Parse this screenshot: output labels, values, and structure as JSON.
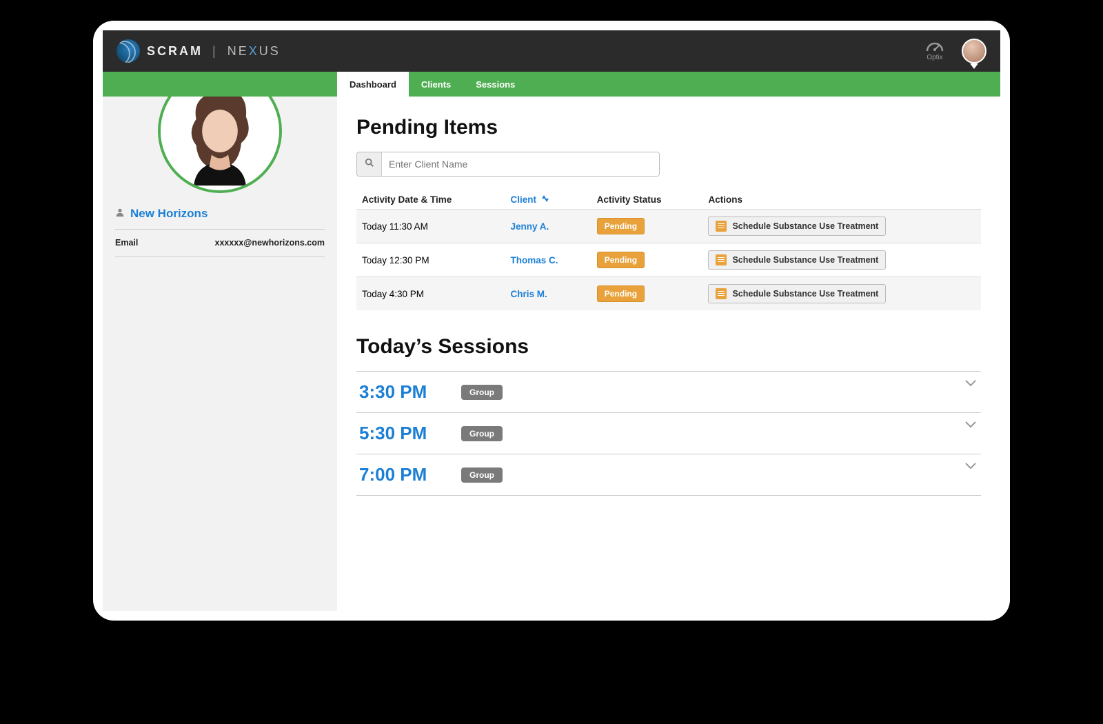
{
  "brand": {
    "scram": "SCRAM",
    "nexus_pre": "NE",
    "nexus_x": "X",
    "nexus_post": "US"
  },
  "topbar": {
    "optix_label": "Optix"
  },
  "tabs": [
    {
      "label": "Dashboard",
      "active": true
    },
    {
      "label": "Clients",
      "active": false
    },
    {
      "label": "Sessions",
      "active": false
    }
  ],
  "sidebar": {
    "org_name": "New Horizons",
    "email_label": "Email",
    "email_value": "xxxxxx@newhorizons.com"
  },
  "pending": {
    "title": "Pending Items",
    "search_placeholder": "Enter Client Name",
    "columns": {
      "datetime": "Activity Date & Time",
      "client": "Client",
      "status": "Activity Status",
      "actions": "Actions"
    },
    "rows": [
      {
        "datetime": "Today 11:30 AM",
        "client": "Jenny A.",
        "status": "Pending",
        "action": "Schedule Substance Use Treatment"
      },
      {
        "datetime": "Today 12:30 PM",
        "client": "Thomas C.",
        "status": "Pending",
        "action": "Schedule Substance Use Treatment"
      },
      {
        "datetime": "Today 4:30 PM",
        "client": "Chris M.",
        "status": "Pending",
        "action": "Schedule Substance Use Treatment"
      }
    ]
  },
  "sessions": {
    "title": "Today’s Sessions",
    "rows": [
      {
        "time": "3:30 PM",
        "type": "Group"
      },
      {
        "time": "5:30 PM",
        "type": "Group"
      },
      {
        "time": "7:00 PM",
        "type": "Group"
      }
    ]
  }
}
